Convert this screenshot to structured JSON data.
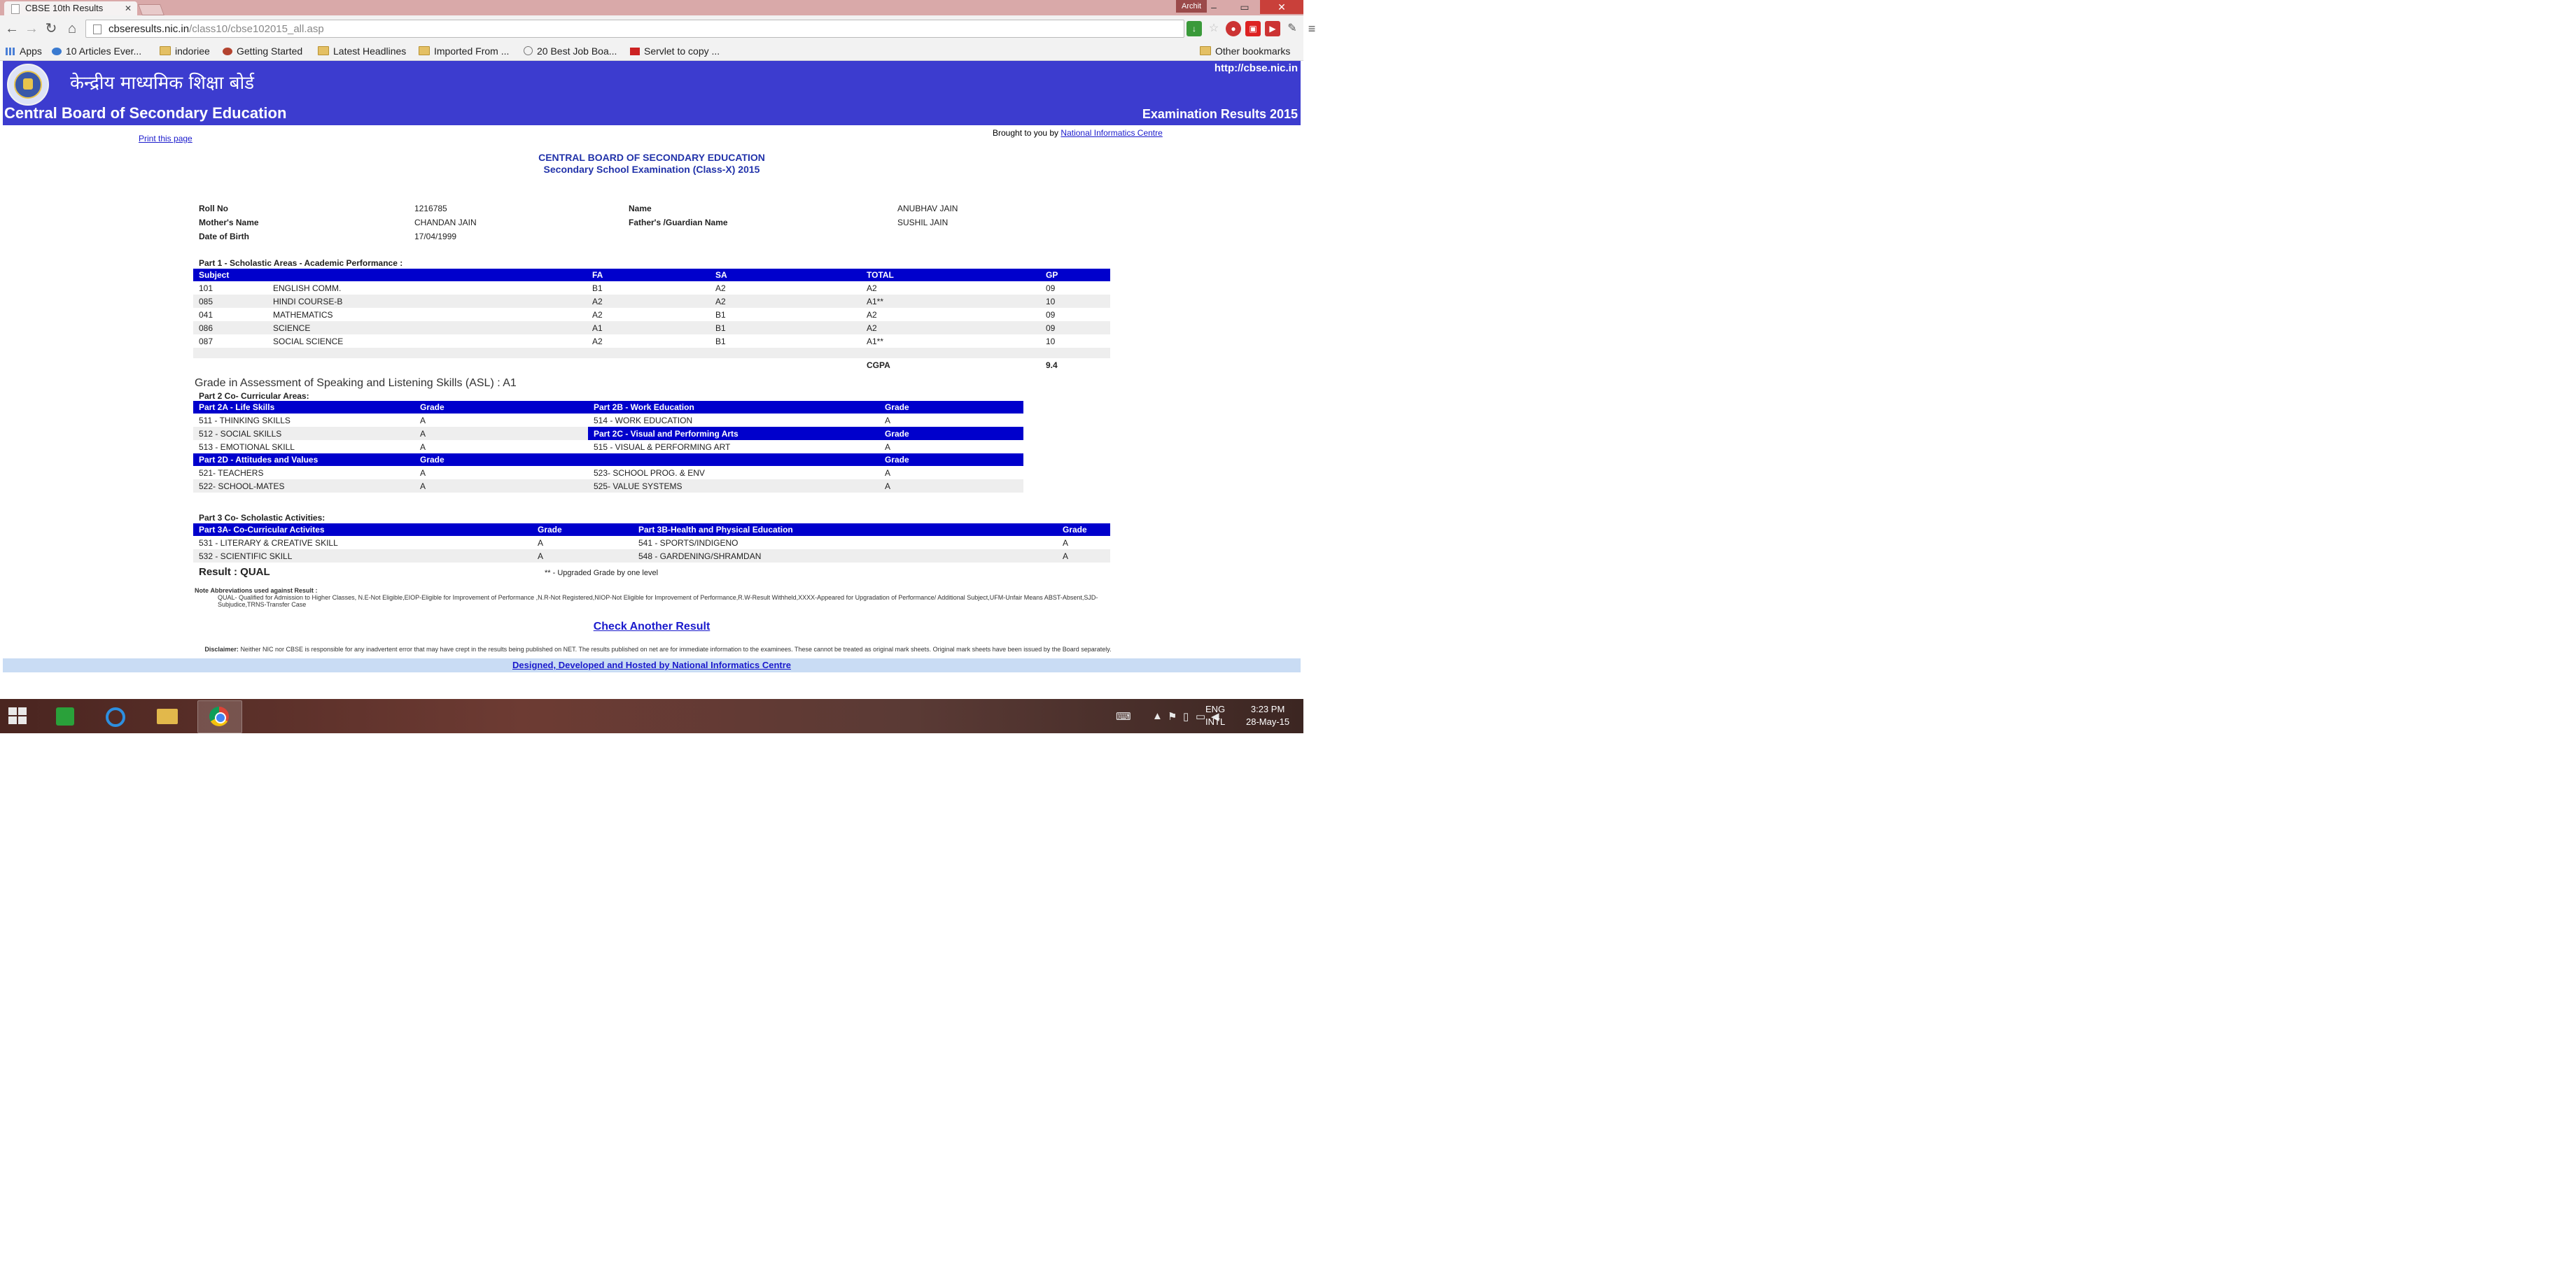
{
  "browser": {
    "tab_title": "CBSE 10th Results",
    "username": "Archit",
    "url_host": "cbseresults.nic.in",
    "url_path": "/class10/cbse102015_all.asp"
  },
  "bookmarks": [
    {
      "label": "Apps",
      "icon": "apps-grid-icon"
    },
    {
      "label": "10 Articles Ever...",
      "icon": "bookmark-page-icon"
    },
    {
      "label": "indoriee",
      "icon": "folder-icon"
    },
    {
      "label": "Getting Started",
      "icon": "bookmark-page-icon"
    },
    {
      "label": "Latest Headlines",
      "icon": "folder-icon"
    },
    {
      "label": "Imported From ...",
      "icon": "folder-icon"
    },
    {
      "label": "20 Best Job Boa...",
      "icon": "bookmark-page-icon"
    },
    {
      "label": "Servlet to copy ...",
      "icon": "bookmark-page-icon"
    },
    {
      "label": "Other bookmarks",
      "icon": "folder-icon"
    }
  ],
  "banner": {
    "hindi": "केन्द्रीय माध्यमिक शिक्षा बोर्ड",
    "title": "Central Board of Secondary Education",
    "site": "http://cbse.nic.in",
    "results": "Examination Results 2015"
  },
  "links": {
    "print": "Print this page",
    "brought_prefix": "Brought to you by",
    "brought_org": "National Informatics Centre"
  },
  "heading": {
    "line1": "CENTRAL BOARD OF SECONDARY EDUCATION",
    "line2": "Secondary School Examination (Class-X) 2015"
  },
  "student": {
    "roll_label": "Roll No",
    "roll": "1216785",
    "name_label": "Name",
    "name": "ANUBHAV JAIN",
    "mother_label": "Mother's Name",
    "mother": "CHANDAN JAIN",
    "father_label": "Father's /Guardian Name",
    "father": "SUSHIL JAIN",
    "dob_label": "Date of Birth",
    "dob": "17/04/1999"
  },
  "part1": {
    "title": "Part 1 - Scholastic Areas - Academic Performance :",
    "headers": [
      "Subject",
      "FA",
      "SA",
      "TOTAL",
      "GP"
    ],
    "rows": [
      {
        "code": "101",
        "subject": "ENGLISH COMM.",
        "fa": "B1",
        "sa": "A2",
        "total": "A2",
        "gp": "09"
      },
      {
        "code": "085",
        "subject": "HINDI COURSE-B",
        "fa": "A2",
        "sa": "A2",
        "total": "A1**",
        "gp": "10"
      },
      {
        "code": "041",
        "subject": "MATHEMATICS",
        "fa": "A2",
        "sa": "B1",
        "total": "A2",
        "gp": "09"
      },
      {
        "code": "086",
        "subject": "SCIENCE",
        "fa": "A1",
        "sa": "B1",
        "total": "A2",
        "gp": "09"
      },
      {
        "code": "087",
        "subject": "SOCIAL SCIENCE",
        "fa": "A2",
        "sa": "B1",
        "total": "A1**",
        "gp": "10"
      }
    ],
    "cgpa_label": "CGPA",
    "cgpa": "9.4"
  },
  "asl": "Grade in Assessment of Speaking and Listening Skills (ASL) : A1",
  "part2": {
    "title": "Part 2 Co- Curricular Areas:",
    "a_header": "Part 2A - Life Skills",
    "b_header": "Part 2B - Work Education",
    "c_header": "Part 2C - Visual and Performing Arts",
    "d_header": "Part 2D - Attitudes and Values",
    "grade_header": "Grade",
    "a_rows": [
      {
        "label": "511 - THINKING SKILLS",
        "grade": "A"
      },
      {
        "label": "512 - SOCIAL SKILLS",
        "grade": "A"
      },
      {
        "label": "513 - EMOTIONAL SKILL",
        "grade": "A"
      }
    ],
    "b_rows": [
      {
        "label": "514 - WORK EDUCATION",
        "grade": "A"
      }
    ],
    "c_rows": [
      {
        "label": "515 - VISUAL & PERFORMING ART",
        "grade": "A"
      }
    ],
    "d_rows": [
      {
        "label": "521- TEACHERS",
        "grade": "A",
        "label2": "523- SCHOOL PROG. & ENV",
        "grade2": "A"
      },
      {
        "label": "522- SCHOOL-MATES",
        "grade": "A",
        "label2": "525- VALUE SYSTEMS",
        "grade2": "A"
      }
    ]
  },
  "part3": {
    "title": "Part 3 Co- Scholastic Activities:",
    "a_header": "Part 3A- Co-Curricular Activites",
    "b_header": "Part 3B-Health and Physical Education",
    "grade_header": "Grade",
    "rows": [
      {
        "a": "531 - LITERARY & CREATIVE SKILL",
        "ag": "A",
        "b": "541 - SPORTS/INDIGENO",
        "bg": "A"
      },
      {
        "a": "532 - SCIENTIFIC SKILL",
        "ag": "A",
        "b": "548 - GARDENING/SHRAMDAN",
        "bg": "A"
      }
    ]
  },
  "result": "Result : QUAL",
  "upgrade_note": "** - Upgraded Grade by one level",
  "note": {
    "label": "Note",
    "heading": "Abbreviations used against Result :",
    "text": "QUAL- Qualified for Admission to Higher Classes, N.E-Not Eligible,EIOP-Eligible for Improvement of Performance ,N.R-Not Registered,NIOP-Not Eligible for Improvement of Performance,R.W-Result Withheld,XXXX-Appeared for Upgradation of Performance/ Additional Subject,UFM-Unfair Means ABST-Absent,SJD-Subjudice,TRNS-Transfer Case"
  },
  "check_another": "Check Another Result",
  "disclaimer_label": "Disclaimer:",
  "disclaimer": "Neither NIC nor CBSE is responsible for any inadvertent error that may have crept in the results being published on NET. The results published on net are for immediate information to the examinees. These cannot be treated as original mark sheets. Original mark sheets have been issued by the Board separately.",
  "footer": "Designed, Developed and Hosted by National Informatics Centre",
  "taskbar": {
    "lang1": "ENG",
    "lang2": "INTL",
    "time": "3:23 PM",
    "date": "28-May-15"
  }
}
